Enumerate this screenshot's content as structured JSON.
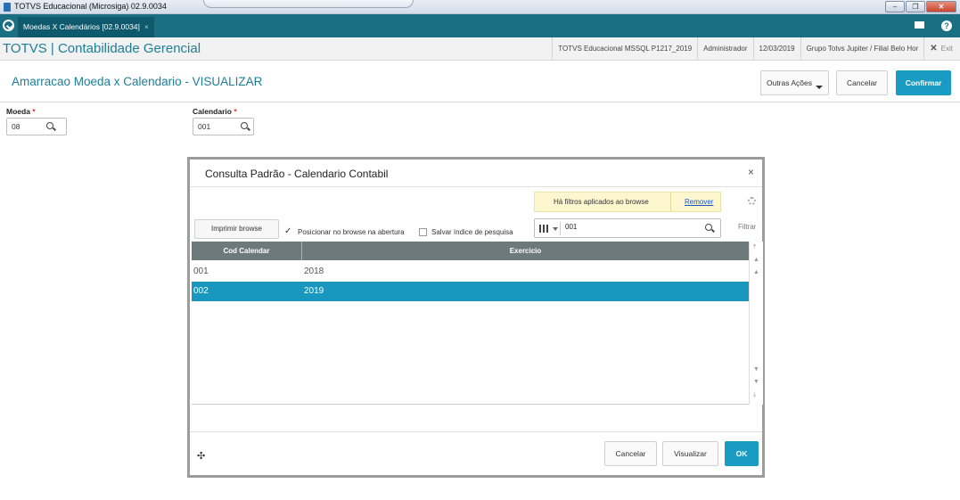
{
  "window": {
    "title": "TOTVS Educacional (Microsiga) 02.9.0034",
    "buttons": [
      "–",
      "❐",
      "✕"
    ]
  },
  "tabs": [
    {
      "label": "Moedas X Calendários [02.9.0034]",
      "close": "×"
    }
  ],
  "app": {
    "brand": "TOTVS | Contabilidade Gerencial",
    "environment": "TOTVS Educacional MSSQL P1217_2019",
    "user": "Administrador",
    "date": "12/03/2019",
    "company": "Grupo Totvs Jupiter / Filial Belo Hor",
    "exit_label": "Exit",
    "exit_icon": "✕"
  },
  "page": {
    "title": "Amarracao Moeda x Calendario - VISUALIZAR",
    "other_actions": "Outras Ações",
    "cancel": "Cancelar",
    "confirm": "Confirmar"
  },
  "form": {
    "moeda": {
      "label": "Moeda",
      "required": "*",
      "value": "08"
    },
    "calendario": {
      "label": "Calendario",
      "required": "*",
      "value": "001"
    }
  },
  "dialog": {
    "title": "Consulta Padrão - Calendario Contabil",
    "close": "×",
    "filter_notice": "Há filtros aplicados ao browse",
    "filter_remove": "Remover",
    "print_button": "Imprimir browse",
    "position_checkbox": {
      "label": "Posicionar no browse na abertura",
      "checked": true,
      "mark": "✓"
    },
    "save_index_checkbox": {
      "label": "Salvar índice de pesquisa",
      "checked": false
    },
    "search_value": "001",
    "filter_link": "Filtrar",
    "columns": [
      "Cod Calendar",
      "Exercicio"
    ],
    "rows": [
      {
        "code": "001",
        "year": "2018",
        "selected": false
      },
      {
        "code": "002",
        "year": "2019",
        "selected": true
      }
    ],
    "move_icon": "✣",
    "scroll_up": [
      "⤒",
      "▲",
      "▲"
    ],
    "scroll_down": [
      "▼",
      "▼",
      "⤓"
    ],
    "buttons": {
      "cancel": "Cancelar",
      "view": "Visualizar",
      "ok": "OK"
    }
  },
  "colors": {
    "teal_bar": "#1a6f83",
    "brand_text": "#1d7e98",
    "primary_button": "#1a9bc4",
    "selected_row": "#1a97be",
    "grid_header": "#6d7a7d",
    "filter_notice_bg": "#fdf7d0"
  }
}
